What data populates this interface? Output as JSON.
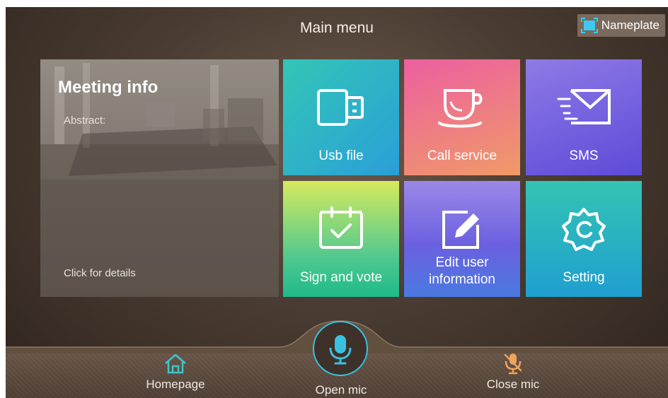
{
  "header": {
    "title": "Main menu"
  },
  "nameplate": {
    "label": "Nameplate",
    "icon": "nameplate-icon"
  },
  "meeting_info": {
    "title": "Meeting info",
    "abstract_label": "Abstract:",
    "details_link": "Click for details"
  },
  "tiles": [
    {
      "label": "Usb file",
      "icon": "usb-file-icon"
    },
    {
      "label": "Call service",
      "icon": "coffee-cup-icon"
    },
    {
      "label": "SMS",
      "icon": "envelope-icon"
    },
    {
      "label": "Sign and vote",
      "icon": "calendar-check-icon"
    },
    {
      "label_line1": "Edit user",
      "label_line2": "information",
      "icon": "edit-icon"
    },
    {
      "label": "Setting",
      "icon": "gear-icon"
    }
  ],
  "bottom_nav": {
    "home_label": "Homepage",
    "open_mic_label": "Open mic",
    "close_mic_label": "Close mic"
  },
  "colors": {
    "accent": "#38c2e2",
    "home_icon": "#3cc6c9",
    "close_mic_icon": "#f0a35a"
  }
}
